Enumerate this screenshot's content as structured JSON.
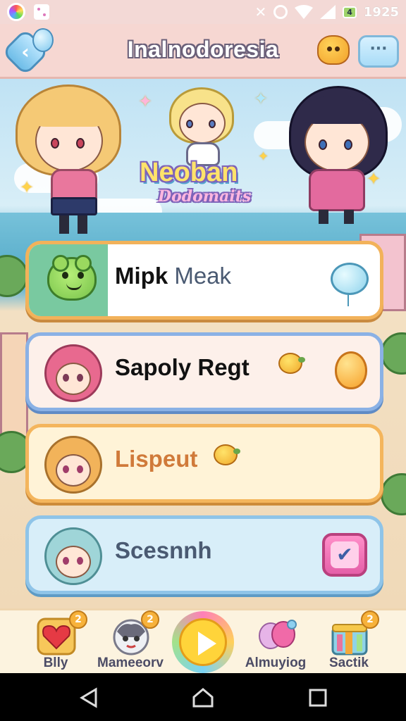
{
  "status_bar": {
    "time": "1925",
    "battery": "4"
  },
  "header": {
    "title": "Inalnodoresia",
    "back_icon": "back-arrow-icon",
    "more_label": "···"
  },
  "banner": {
    "logo_line1": "Neoban",
    "logo_line2": "Dodomaits"
  },
  "menu": [
    {
      "label": "Mipk",
      "label_accent": "Meak",
      "trail": "heart-balloon-icon"
    },
    {
      "label": "Sapoly Regt",
      "trail": "orange-balloon-icon"
    },
    {
      "label": "Lispeut",
      "trail": ""
    },
    {
      "label": "Scesnnh",
      "trail": "checkbox-icon"
    }
  ],
  "bottom_nav": [
    {
      "label": "Blly",
      "badge": "2",
      "icon": "heart-icon"
    },
    {
      "label": "Mameeorv",
      "badge": "2",
      "icon": "cat-icon"
    },
    {
      "label": "",
      "badge": "",
      "icon": "play-icon"
    },
    {
      "label": "Almuyiog",
      "badge": "",
      "icon": "balloons-icon"
    },
    {
      "label": "Sactik",
      "badge": "2",
      "icon": "gift-box-icon"
    }
  ],
  "colors": {
    "header_bg": "#f6d7d2",
    "card1_border": "#f2b25a",
    "card2_border": "#8ab1e5",
    "card3_border": "#f4b55c",
    "card4_border": "#8fc4e8",
    "title_outline": "#6b6079"
  }
}
